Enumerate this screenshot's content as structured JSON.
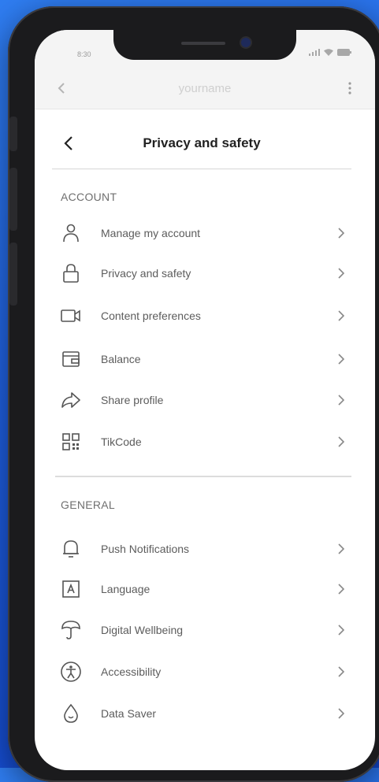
{
  "status": {
    "time": "8:30"
  },
  "topbar": {
    "username": "yourname"
  },
  "header": {
    "title": "Privacy and safety"
  },
  "account": {
    "title": "ACCOUNT",
    "items": [
      {
        "label": "Manage my account",
        "icon": "person-icon"
      },
      {
        "label": "Privacy and safety",
        "icon": "lock-icon"
      },
      {
        "label": "Content preferences",
        "icon": "video-camera-icon"
      },
      {
        "label": "Balance",
        "icon": "wallet-icon"
      },
      {
        "label": "Share profile",
        "icon": "share-arrow-icon"
      },
      {
        "label": "TikCode",
        "icon": "qr-code-icon"
      }
    ]
  },
  "general": {
    "title": "GENERAL",
    "items": [
      {
        "label": "Push Notifications",
        "icon": "bell-icon"
      },
      {
        "label": "Language",
        "icon": "language-icon"
      },
      {
        "label": "Digital Wellbeing",
        "icon": "umbrella-icon"
      },
      {
        "label": "Accessibility",
        "icon": "accessibility-icon"
      },
      {
        "label": "Data Saver",
        "icon": "droplet-icon"
      }
    ]
  },
  "colors": {
    "background": "#2a6fe8",
    "screen": "#ffffff",
    "text": "#5c5c5c"
  }
}
